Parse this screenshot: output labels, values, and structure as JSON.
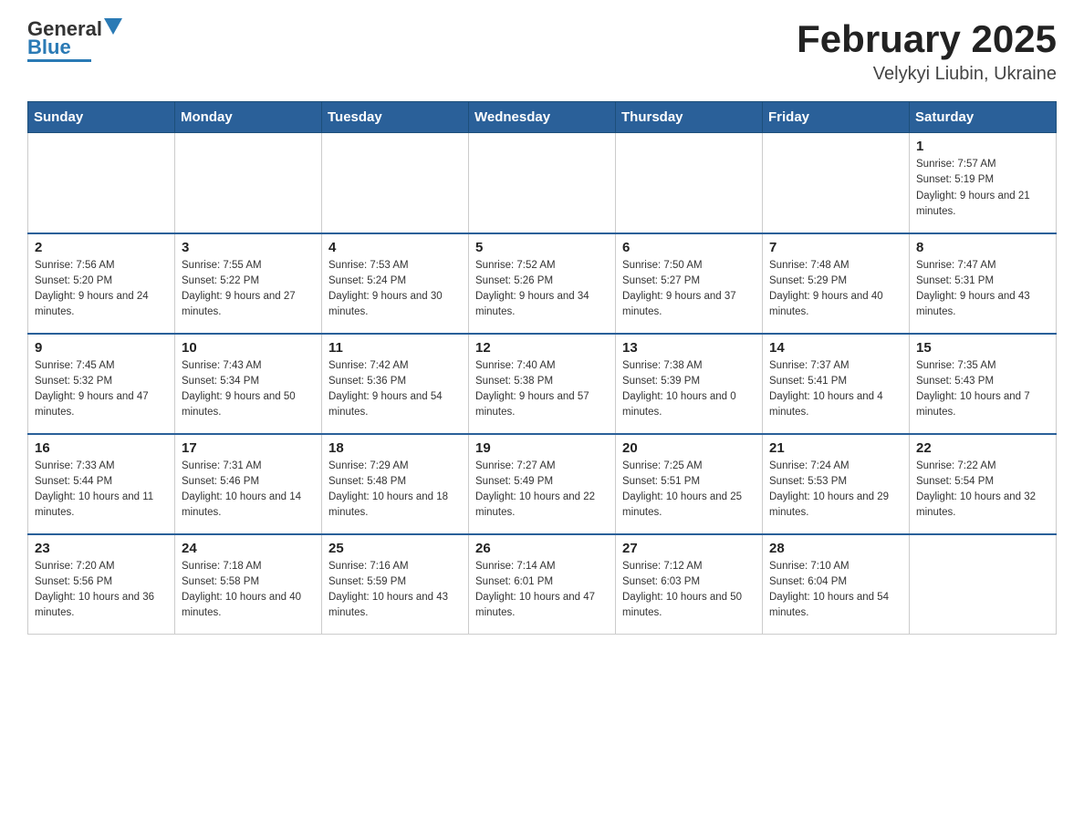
{
  "header": {
    "logo_general": "General",
    "logo_blue": "Blue",
    "month_year": "February 2025",
    "location": "Velykyi Liubin, Ukraine"
  },
  "days_of_week": [
    "Sunday",
    "Monday",
    "Tuesday",
    "Wednesday",
    "Thursday",
    "Friday",
    "Saturday"
  ],
  "weeks": [
    [
      {
        "day": "",
        "info": ""
      },
      {
        "day": "",
        "info": ""
      },
      {
        "day": "",
        "info": ""
      },
      {
        "day": "",
        "info": ""
      },
      {
        "day": "",
        "info": ""
      },
      {
        "day": "",
        "info": ""
      },
      {
        "day": "1",
        "info": "Sunrise: 7:57 AM\nSunset: 5:19 PM\nDaylight: 9 hours and 21 minutes."
      }
    ],
    [
      {
        "day": "2",
        "info": "Sunrise: 7:56 AM\nSunset: 5:20 PM\nDaylight: 9 hours and 24 minutes."
      },
      {
        "day": "3",
        "info": "Sunrise: 7:55 AM\nSunset: 5:22 PM\nDaylight: 9 hours and 27 minutes."
      },
      {
        "day": "4",
        "info": "Sunrise: 7:53 AM\nSunset: 5:24 PM\nDaylight: 9 hours and 30 minutes."
      },
      {
        "day": "5",
        "info": "Sunrise: 7:52 AM\nSunset: 5:26 PM\nDaylight: 9 hours and 34 minutes."
      },
      {
        "day": "6",
        "info": "Sunrise: 7:50 AM\nSunset: 5:27 PM\nDaylight: 9 hours and 37 minutes."
      },
      {
        "day": "7",
        "info": "Sunrise: 7:48 AM\nSunset: 5:29 PM\nDaylight: 9 hours and 40 minutes."
      },
      {
        "day": "8",
        "info": "Sunrise: 7:47 AM\nSunset: 5:31 PM\nDaylight: 9 hours and 43 minutes."
      }
    ],
    [
      {
        "day": "9",
        "info": "Sunrise: 7:45 AM\nSunset: 5:32 PM\nDaylight: 9 hours and 47 minutes."
      },
      {
        "day": "10",
        "info": "Sunrise: 7:43 AM\nSunset: 5:34 PM\nDaylight: 9 hours and 50 minutes."
      },
      {
        "day": "11",
        "info": "Sunrise: 7:42 AM\nSunset: 5:36 PM\nDaylight: 9 hours and 54 minutes."
      },
      {
        "day": "12",
        "info": "Sunrise: 7:40 AM\nSunset: 5:38 PM\nDaylight: 9 hours and 57 minutes."
      },
      {
        "day": "13",
        "info": "Sunrise: 7:38 AM\nSunset: 5:39 PM\nDaylight: 10 hours and 0 minutes."
      },
      {
        "day": "14",
        "info": "Sunrise: 7:37 AM\nSunset: 5:41 PM\nDaylight: 10 hours and 4 minutes."
      },
      {
        "day": "15",
        "info": "Sunrise: 7:35 AM\nSunset: 5:43 PM\nDaylight: 10 hours and 7 minutes."
      }
    ],
    [
      {
        "day": "16",
        "info": "Sunrise: 7:33 AM\nSunset: 5:44 PM\nDaylight: 10 hours and 11 minutes."
      },
      {
        "day": "17",
        "info": "Sunrise: 7:31 AM\nSunset: 5:46 PM\nDaylight: 10 hours and 14 minutes."
      },
      {
        "day": "18",
        "info": "Sunrise: 7:29 AM\nSunset: 5:48 PM\nDaylight: 10 hours and 18 minutes."
      },
      {
        "day": "19",
        "info": "Sunrise: 7:27 AM\nSunset: 5:49 PM\nDaylight: 10 hours and 22 minutes."
      },
      {
        "day": "20",
        "info": "Sunrise: 7:25 AM\nSunset: 5:51 PM\nDaylight: 10 hours and 25 minutes."
      },
      {
        "day": "21",
        "info": "Sunrise: 7:24 AM\nSunset: 5:53 PM\nDaylight: 10 hours and 29 minutes."
      },
      {
        "day": "22",
        "info": "Sunrise: 7:22 AM\nSunset: 5:54 PM\nDaylight: 10 hours and 32 minutes."
      }
    ],
    [
      {
        "day": "23",
        "info": "Sunrise: 7:20 AM\nSunset: 5:56 PM\nDaylight: 10 hours and 36 minutes."
      },
      {
        "day": "24",
        "info": "Sunrise: 7:18 AM\nSunset: 5:58 PM\nDaylight: 10 hours and 40 minutes."
      },
      {
        "day": "25",
        "info": "Sunrise: 7:16 AM\nSunset: 5:59 PM\nDaylight: 10 hours and 43 minutes."
      },
      {
        "day": "26",
        "info": "Sunrise: 7:14 AM\nSunset: 6:01 PM\nDaylight: 10 hours and 47 minutes."
      },
      {
        "day": "27",
        "info": "Sunrise: 7:12 AM\nSunset: 6:03 PM\nDaylight: 10 hours and 50 minutes."
      },
      {
        "day": "28",
        "info": "Sunrise: 7:10 AM\nSunset: 6:04 PM\nDaylight: 10 hours and 54 minutes."
      },
      {
        "day": "",
        "info": ""
      }
    ]
  ]
}
